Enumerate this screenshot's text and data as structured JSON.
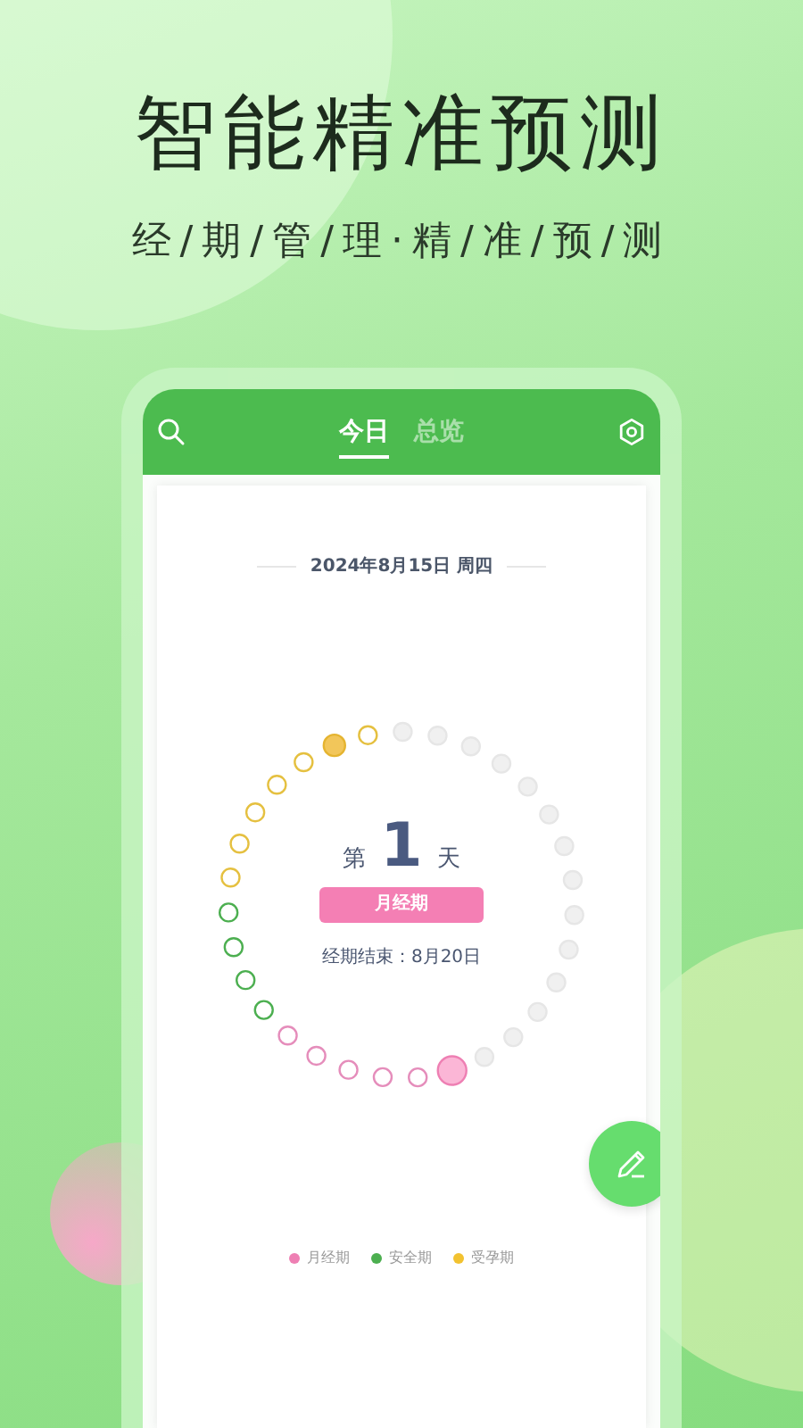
{
  "headline": "智能精准预测",
  "subtitle": "经/期/管/理·精/准/预/测",
  "tabs": [
    {
      "label": "今日",
      "selected": true
    },
    {
      "label": "总览",
      "selected": false
    }
  ],
  "date": "2024年8月15日 周四",
  "cycle": {
    "prefix": "第",
    "day": "1",
    "suffix": "天",
    "phase": "月经期",
    "end_note": "经期结束：8月20日",
    "dots": [
      {
        "kind": "today"
      },
      {
        "kind": "period"
      },
      {
        "kind": "period"
      },
      {
        "kind": "period"
      },
      {
        "kind": "period"
      },
      {
        "kind": "period"
      },
      {
        "kind": "safe"
      },
      {
        "kind": "safe"
      },
      {
        "kind": "safe"
      },
      {
        "kind": "safe"
      },
      {
        "kind": "fertile"
      },
      {
        "kind": "fertile"
      },
      {
        "kind": "fertile"
      },
      {
        "kind": "fertile"
      },
      {
        "kind": "fertile"
      },
      {
        "kind": "peak"
      },
      {
        "kind": "fertile"
      },
      {
        "kind": "future"
      },
      {
        "kind": "future"
      },
      {
        "kind": "future"
      },
      {
        "kind": "future"
      },
      {
        "kind": "future"
      },
      {
        "kind": "future"
      },
      {
        "kind": "future"
      },
      {
        "kind": "future"
      },
      {
        "kind": "future"
      },
      {
        "kind": "future"
      },
      {
        "kind": "future"
      },
      {
        "kind": "future"
      },
      {
        "kind": "future"
      },
      {
        "kind": "future"
      }
    ]
  },
  "legend": [
    {
      "label": "月经期",
      "color": "#ee7fb3"
    },
    {
      "label": "安全期",
      "color": "#4caf50"
    },
    {
      "label": "受孕期",
      "color": "#f2c230"
    }
  ]
}
